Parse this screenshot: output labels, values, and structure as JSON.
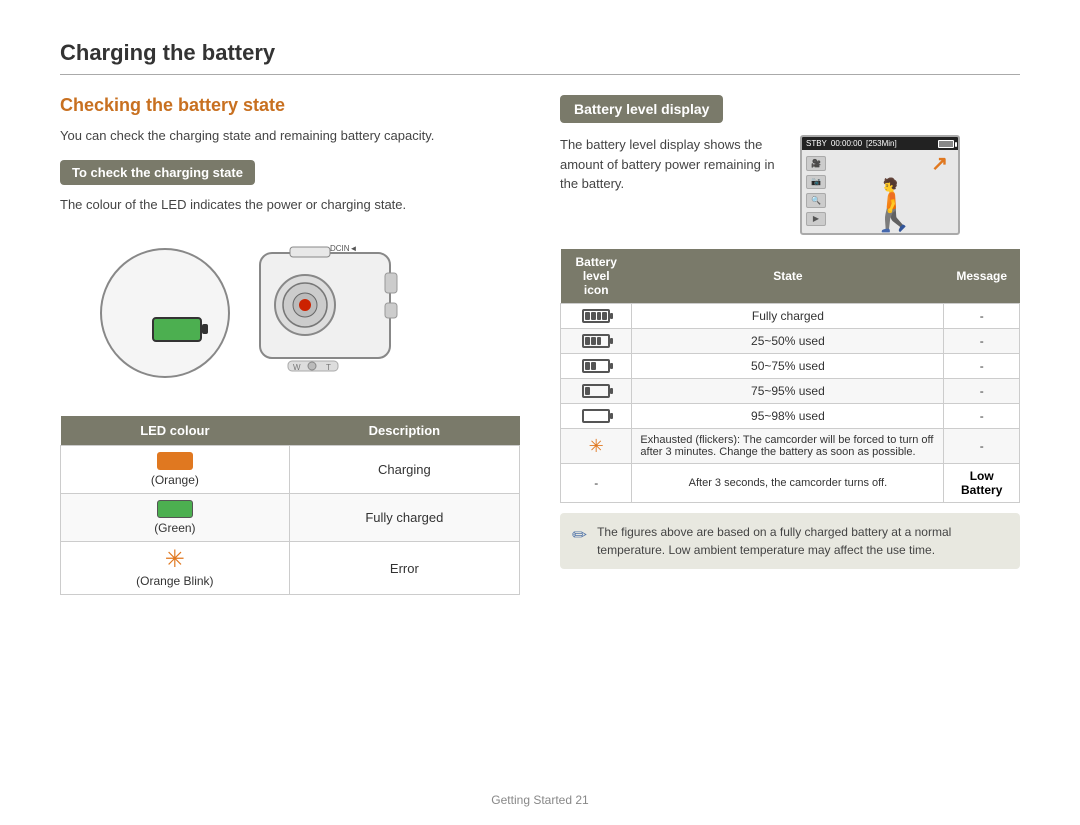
{
  "page": {
    "title": "Charging the battery",
    "footer": "Getting Started  21"
  },
  "left": {
    "section_title": "Checking the battery state",
    "intro_text": "You can check the charging state and remaining battery capacity.",
    "subsection_title": "To check the charging state",
    "led_note": "The colour of the LED indicates the power or charging state.",
    "led_table": {
      "headers": [
        "LED colour",
        "Description"
      ],
      "rows": [
        {
          "colour": "Orange",
          "desc": "Charging"
        },
        {
          "colour": "Green",
          "desc": "Fully charged"
        },
        {
          "colour": "Orange Blink",
          "desc": "Error"
        }
      ]
    }
  },
  "right": {
    "section_title": "Battery level display",
    "display_text": "The battery level display shows the amount of battery power remaining in the battery.",
    "screen": {
      "status_text": "STBY 00:00:00 [253Min]"
    },
    "battery_table": {
      "headers": [
        "Battery level icon",
        "State",
        "Message"
      ],
      "rows": [
        {
          "state": "Fully charged",
          "message": "-",
          "segs": 4
        },
        {
          "state": "25~50% used",
          "message": "-",
          "segs": 3
        },
        {
          "state": "50~75% used",
          "message": "-",
          "segs": 2
        },
        {
          "state": "75~95% used",
          "message": "-",
          "segs": 1
        },
        {
          "state": "95~98% used",
          "message": "-",
          "segs": 0
        },
        {
          "state": "Exhausted (flickers): The camcorder will be forced to turn off after 3 minutes. Change the battery as soon as possible.",
          "message": "-",
          "segs": -1
        },
        {
          "state": "After 3 seconds, the camcorder turns off.",
          "message": "Low Battery",
          "segs": -2
        }
      ]
    },
    "note_text": "The figures above are based on a fully charged battery at a normal temperature. Low ambient temperature may affect the use time."
  }
}
